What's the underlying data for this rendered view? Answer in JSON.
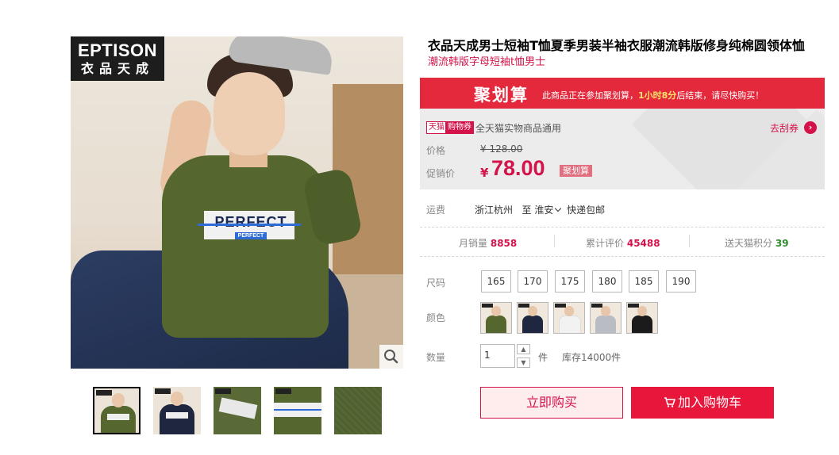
{
  "gallery": {
    "brand_en": "EPTISON",
    "brand_cn": "衣品天成",
    "shirt_print": "PERFECT",
    "shirt_print_sub": "PERFECT",
    "zoom_icon": "magnifier-icon",
    "thumbnails": [
      {
        "name": "thumb-green-tee",
        "color": "#55672f"
      },
      {
        "name": "thumb-navy-tee",
        "color": "#1e2640"
      },
      {
        "name": "thumb-tag-detail",
        "color": "#5a6a36"
      },
      {
        "name": "thumb-print-detail",
        "color": "#55672f"
      },
      {
        "name": "thumb-fabric-detail",
        "color": "#4f6130"
      }
    ]
  },
  "product": {
    "title": "衣品天成男士短袖T恤夏季男装半袖衣服潮流韩版修身纯棉圆领体恤",
    "subtitle": "潮流韩版字母短袖t恤男士"
  },
  "promo": {
    "logo": "聚划算",
    "msg_before": "此商品正在参加聚划算，",
    "msg_time": "1小时8分",
    "msg_after": "后结束，请尽快购买！"
  },
  "coupon": {
    "tag_tmall": "天猫",
    "tag_coupon": "购物券",
    "text": "全天猫实物商品通用",
    "link": "去刮券",
    "arrow": "›"
  },
  "price": {
    "orig_label": "价格",
    "orig_value": "¥ 128.00",
    "promo_label": "促销价",
    "currency": "¥",
    "promo_value": "78.00",
    "promo_badge": "聚划算"
  },
  "shipping": {
    "label": "运费",
    "from": "浙江杭州",
    "to_word": "至",
    "to": "淮安",
    "method": "快递包邮"
  },
  "stats": {
    "monthly_label": "月销量",
    "monthly_value": "8858",
    "reviews_label": "累计评价",
    "reviews_value": "45488",
    "points_label": "送天猫积分",
    "points_value": "39"
  },
  "sku": {
    "size_label": "尺码",
    "sizes": [
      "165",
      "170",
      "175",
      "180",
      "185",
      "190"
    ],
    "color_label": "颜色",
    "colors": [
      {
        "name": "color-army-green",
        "color": "#55672f"
      },
      {
        "name": "color-navy",
        "color": "#1e2640"
      },
      {
        "name": "color-white",
        "color": "#f2f2f2"
      },
      {
        "name": "color-grey",
        "color": "#b9bcc2"
      },
      {
        "name": "color-black",
        "color": "#1b1b1b"
      }
    ],
    "qty_label": "数量",
    "qty_value": "1",
    "qty_unit": "件",
    "stock": "库存14000件"
  },
  "actions": {
    "buy_now": "立即购买",
    "add_cart": "加入购物车",
    "cart_icon": "shopping-cart-icon"
  },
  "colors": {
    "accent": "#d3134a",
    "jhs_red": "#e4293c",
    "cart_red": "#e8163b"
  }
}
